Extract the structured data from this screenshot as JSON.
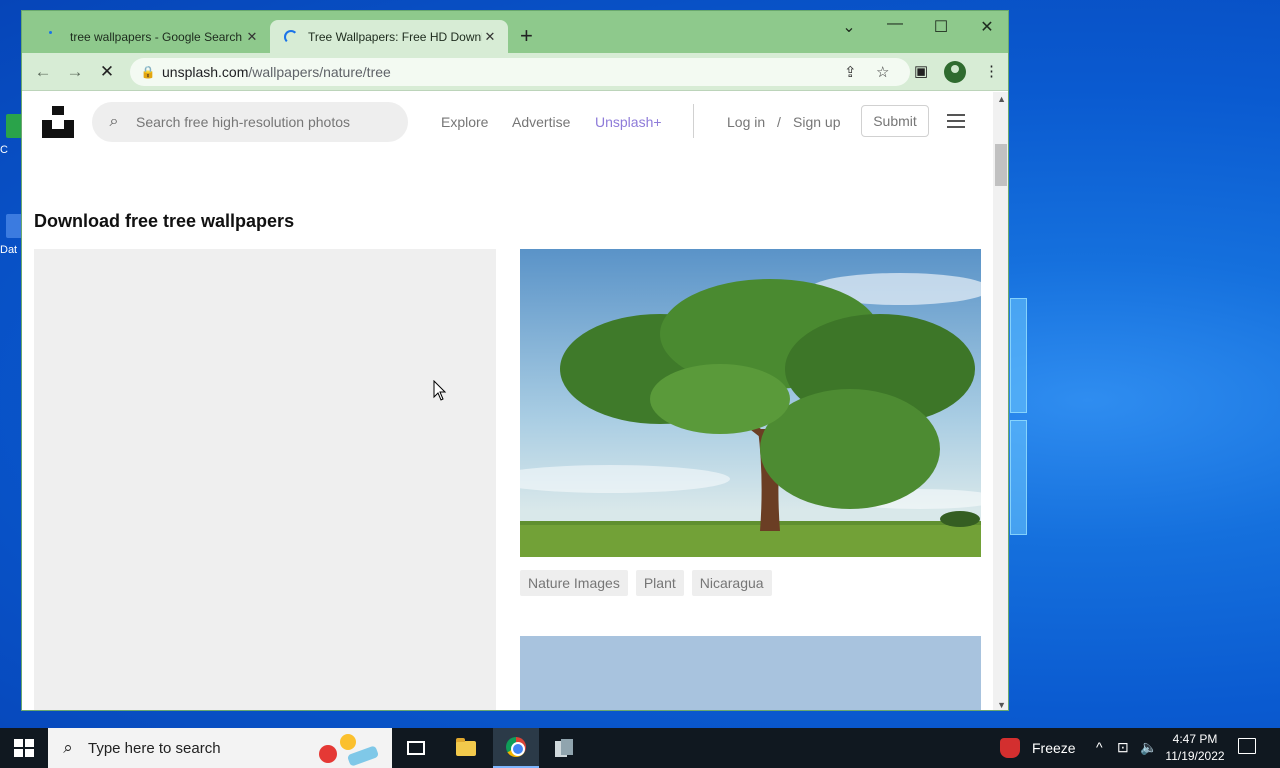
{
  "desktop": {
    "icon_labels": [
      "C",
      "Dat"
    ]
  },
  "browser": {
    "tabs": [
      {
        "title": "tree wallpapers - Google Search",
        "close": "✕"
      },
      {
        "title": "Tree Wallpapers: Free HD Download",
        "close": "✕"
      }
    ],
    "new_tab": "+",
    "window_controls": {
      "tab_search": "⌄",
      "minimize": "—",
      "maximize": "☐",
      "close": "✕"
    },
    "nav": {
      "back": "←",
      "forward": "→",
      "stop": "✕"
    },
    "omnibox": {
      "host": "unsplash.com",
      "path": "/wallpapers/nature/tree",
      "lock": "🔒"
    },
    "toolbar_icons": {
      "share": "⇪",
      "bookmark": "☆",
      "side_panel": "▣",
      "menu": "⋮"
    }
  },
  "site": {
    "search_placeholder": "Search free high-resolution photos",
    "search_icon": "⌕",
    "nav": {
      "explore": "Explore",
      "advertise": "Advertise",
      "unsplash_plus": "Unsplash+",
      "login": "Log in",
      "separator": "/",
      "signup": "Sign up",
      "submit": "Submit"
    },
    "heading": "Download free tree wallpapers",
    "photo_tags": [
      "Nature Images",
      "Plant",
      "Nicaragua"
    ]
  },
  "taskbar": {
    "search_placeholder": "Type here to search",
    "freeze_label": "Freeze",
    "clock": {
      "time": "4:47 PM",
      "date": "11/19/2022"
    },
    "tray_up": "^",
    "tray_network": "⊡",
    "tray_volume": "🔈"
  },
  "colors": {
    "tabstrip": "#8ec98c",
    "toolbar": "#d7ecd5",
    "unsplash_plus": "#8e7bd9",
    "taskbar": "#101820"
  }
}
